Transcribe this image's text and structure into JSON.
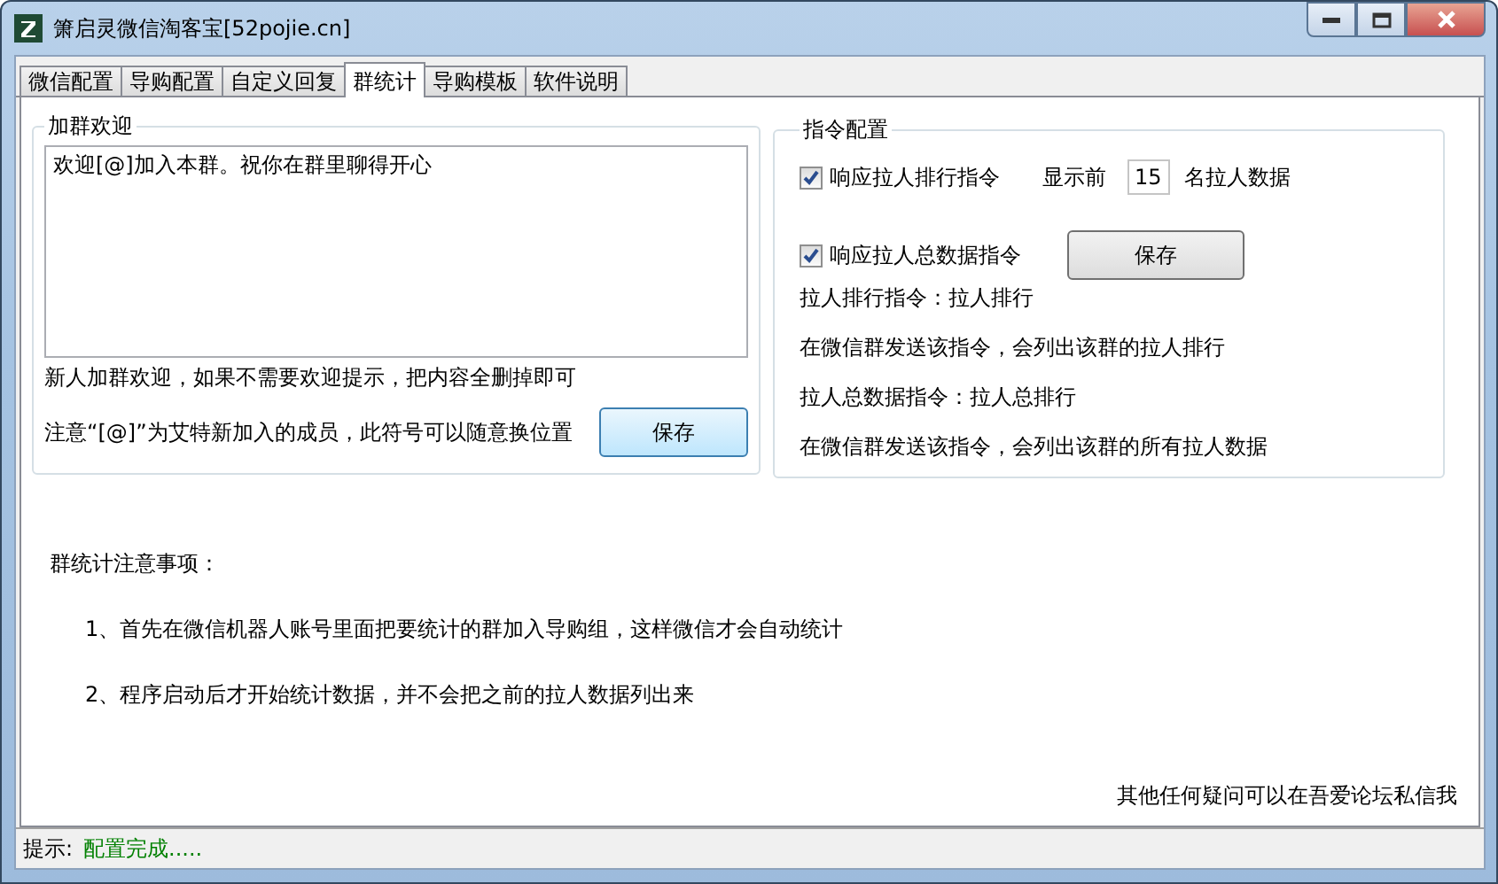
{
  "window": {
    "title": "箫启灵微信淘客宝[52pojie.cn]"
  },
  "tabs": [
    {
      "label": "微信配置",
      "selected": false
    },
    {
      "label": "导购配置",
      "selected": false
    },
    {
      "label": "自定义回复",
      "selected": false
    },
    {
      "label": "群统计",
      "selected": true
    },
    {
      "label": "导购模板",
      "selected": false
    },
    {
      "label": "软件说明",
      "selected": false
    }
  ],
  "welcome": {
    "title": "加群欢迎",
    "message": "欢迎[@]加入本群。祝你在群里聊得开心",
    "hint": "新人加群欢迎，如果不需要欢迎提示，把内容全删掉即可",
    "note": "注意“[@]”为艾特新加入的成员，此符号可以随意换位置",
    "save_button": "保存"
  },
  "commands": {
    "title": "指令配置",
    "rank_checkbox": {
      "label": "响应拉人排行指令",
      "checked": true
    },
    "show_prefix": "显示前",
    "count": "15",
    "show_suffix": "名拉人数据",
    "total_checkbox": {
      "label": "响应拉人总数据指令",
      "checked": true
    },
    "save_button": "保存",
    "lines": [
      "拉人排行指令：拉人排行",
      "在微信群发送该指令，会列出该群的拉人排行",
      "拉人总数据指令：拉人总排行",
      "在微信群发送该指令，会列出该群的所有拉人数据"
    ]
  },
  "notes": {
    "title": "群统计注意事项：",
    "items": [
      "1、首先在微信机器人账号里面把要统计的群加入导购组，这样微信才会自动统计",
      "2、程序启动后才开始统计数据，并不会把之前的拉人数据列出来"
    ]
  },
  "footer": "其他任何疑问可以在吾爱论坛私信我",
  "status_bar": {
    "label": "提示:",
    "message": "配置完成....."
  }
}
